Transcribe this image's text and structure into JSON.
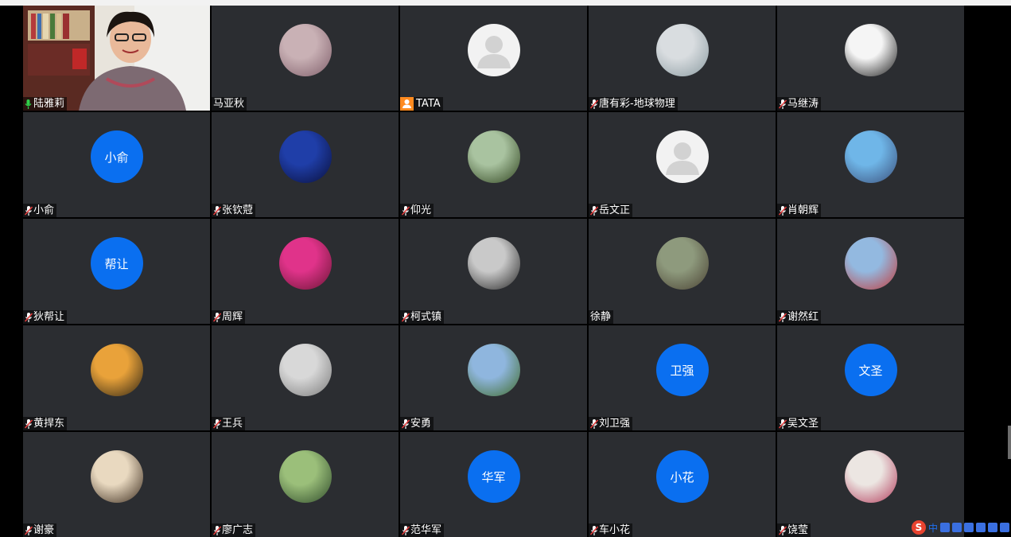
{
  "window": {
    "accent": "#0a6ff0",
    "active_border": "#2fb14a",
    "tile_bg": "#2b2d31"
  },
  "participants": [
    {
      "name": "陆雅莉",
      "avatar_type": "video",
      "mic": "active",
      "active": true
    },
    {
      "name": "马亚秋",
      "avatar_type": "photo",
      "mic": "none",
      "colors": [
        "#c9b1b5",
        "#7f5e6a"
      ]
    },
    {
      "name": "TATA",
      "avatar_type": "default-user",
      "mic": "user-badge"
    },
    {
      "name": "唐有彩-地球物理",
      "avatar_type": "photo",
      "mic": "muted",
      "colors": [
        "#d9dde0",
        "#8a9aa0"
      ]
    },
    {
      "name": "马继涛",
      "avatar_type": "photo",
      "mic": "muted",
      "colors": [
        "#f5f5f5",
        "#1a1a1a"
      ]
    },
    {
      "name": "小俞",
      "avatar_type": "text",
      "avatar_text": "小俞",
      "mic": "muted"
    },
    {
      "name": "张钦蒄",
      "avatar_type": "photo",
      "mic": "muted",
      "colors": [
        "#1f3ea8",
        "#0a0f3a"
      ]
    },
    {
      "name": "仰光",
      "avatar_type": "photo",
      "mic": "muted",
      "colors": [
        "#a9c3a0",
        "#30441f"
      ]
    },
    {
      "name": "岳文正",
      "avatar_type": "default-user",
      "mic": "muted"
    },
    {
      "name": "肖朝辉",
      "avatar_type": "photo",
      "mic": "muted",
      "colors": [
        "#6fb6e8",
        "#3b4f7a"
      ]
    },
    {
      "name": "狄帮让",
      "avatar_type": "text",
      "avatar_text": "帮让",
      "mic": "muted"
    },
    {
      "name": "周辉",
      "avatar_type": "photo",
      "mic": "muted",
      "colors": [
        "#e0338a",
        "#6a1634"
      ]
    },
    {
      "name": "柯式镇",
      "avatar_type": "photo",
      "mic": "muted",
      "colors": [
        "#c9c9c9",
        "#262626"
      ]
    },
    {
      "name": "徐静",
      "avatar_type": "photo",
      "mic": "none",
      "colors": [
        "#8e9a7d",
        "#4a4233"
      ]
    },
    {
      "name": "谢然红",
      "avatar_type": "photo",
      "mic": "muted",
      "colors": [
        "#93b9e0",
        "#c23b3b"
      ]
    },
    {
      "name": "黄捍东",
      "avatar_type": "photo",
      "mic": "muted",
      "colors": [
        "#e9a23a",
        "#2c2414"
      ]
    },
    {
      "name": "王兵",
      "avatar_type": "photo",
      "mic": "muted",
      "colors": [
        "#d8d8d8",
        "#7a7a7a"
      ]
    },
    {
      "name": "安勇",
      "avatar_type": "photo",
      "mic": "muted",
      "colors": [
        "#8fb6de",
        "#3f6b2a"
      ]
    },
    {
      "name": "刘卫强",
      "avatar_type": "text",
      "avatar_text": "卫强",
      "mic": "muted"
    },
    {
      "name": "吴文圣",
      "avatar_type": "text",
      "avatar_text": "文圣",
      "mic": "muted"
    },
    {
      "name": "谢豪",
      "avatar_type": "photo",
      "mic": "muted",
      "colors": [
        "#e9d9c0",
        "#3a2a1c"
      ]
    },
    {
      "name": "廖广志",
      "avatar_type": "photo",
      "mic": "muted",
      "colors": [
        "#9bbf7a",
        "#2e4a2a"
      ]
    },
    {
      "name": "范华军",
      "avatar_type": "text",
      "avatar_text": "华军",
      "mic": "muted"
    },
    {
      "name": "车小花",
      "avatar_type": "text",
      "avatar_text": "小花",
      "mic": "muted"
    },
    {
      "name": "饶莹",
      "avatar_type": "photo",
      "mic": "muted",
      "colors": [
        "#ece6e2",
        "#b23a5a"
      ]
    }
  ],
  "taskbar": {
    "ime_label": "中",
    "ime_logo": "S"
  }
}
